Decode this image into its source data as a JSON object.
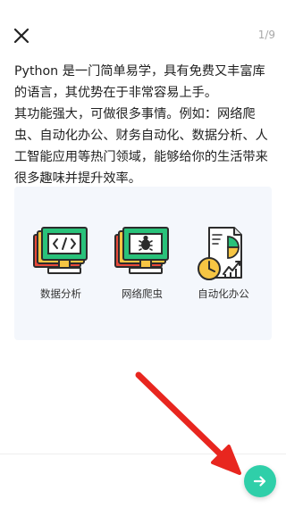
{
  "header": {
    "close_icon": "close-icon",
    "page_counter": "1/9"
  },
  "intro": {
    "paragraphs": [
      "Python 是一门简单易学，具有免费又丰富库的语言，其优势在于非常容易上手。",
      "其功能强大，可做很多事情。例如：网络爬虫、自动化办公、财务自动化、数据分析、人工智能应用等热门领域，能够给你的生活带来很多趣味并提升效率。"
    ]
  },
  "features": [
    {
      "label": "数据分析",
      "icon": "code-monitor-icon"
    },
    {
      "label": "网络爬虫",
      "icon": "bug-monitor-icon"
    },
    {
      "label": "自动化办公",
      "icon": "report-clock-icon"
    }
  ],
  "footer": {
    "next_icon": "arrow-right-icon",
    "accent_color": "#2fcfa9",
    "annotation_color": "#e8261f"
  }
}
